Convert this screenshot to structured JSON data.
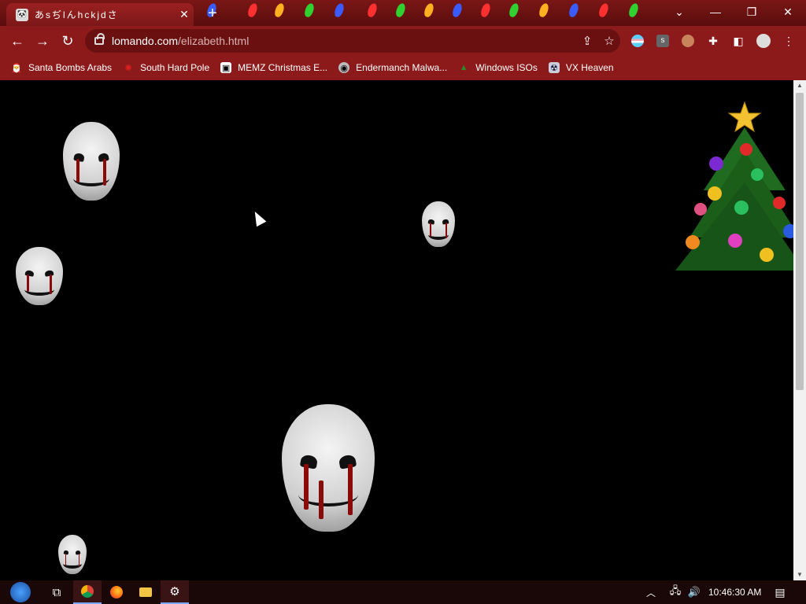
{
  "browser": {
    "tab_title": "あsぢlんhckjdさ",
    "tab_favicon": "panda-icon",
    "new_tab_label": "+",
    "url_domain": "lomando.com",
    "url_path": "/elizabeth.html",
    "colors": {
      "frame": "#7a1616",
      "toolbar": "#8c1a1a",
      "omnibox": "#6b1010"
    }
  },
  "bookmarks": [
    {
      "label": "Santa Bombs Arabs",
      "icon": "santa-icon"
    },
    {
      "label": "South Hard Pole",
      "icon": "red-ornament-icon"
    },
    {
      "label": "MEMZ Christmas E...",
      "icon": "memz-icon"
    },
    {
      "label": "Endermanch Malwa...",
      "icon": "raccoon-icon"
    },
    {
      "label": "Windows ISOs",
      "icon": "christmas-tree-icon"
    },
    {
      "label": "VX Heaven",
      "icon": "vx-icon"
    }
  ],
  "page": {
    "background": "#000000",
    "masks": [
      "mask-image",
      "mask-image",
      "mask-image",
      "mask-image",
      "mask-image"
    ],
    "decoration": "christmas-tree"
  },
  "taskbar": {
    "items": [
      "start-button",
      "task-view",
      "chrome",
      "firefox",
      "file-explorer",
      "settings"
    ],
    "clock": "10:46:30 AM"
  }
}
